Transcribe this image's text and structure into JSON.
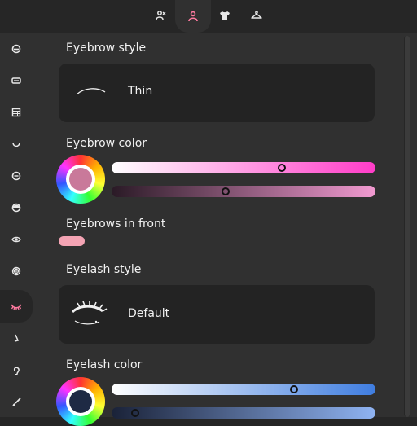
{
  "colors": {
    "accent": "#ff7aa0",
    "background": "#303030",
    "card": "#232323",
    "toggle": "#f4a4b4"
  },
  "top_tabs": [
    {
      "name": "tab-people",
      "icon": "people-icon",
      "active": false
    },
    {
      "name": "tab-body",
      "icon": "person-icon",
      "active": true
    },
    {
      "name": "tab-clothing",
      "icon": "shirt-icon",
      "active": false
    },
    {
      "name": "tab-hanger",
      "icon": "hanger-icon",
      "active": false
    }
  ],
  "sidebar_icons": [
    "head-icon",
    "forehead-icon",
    "hair-icon",
    "mouth-icon",
    "face-icon",
    "face-outline-icon",
    "eye-icon",
    "pupil-icon",
    "eyelash-icon",
    "eyebrow-pen-icon",
    "ear-icon",
    "brush-icon"
  ],
  "sections": {
    "eyebrow_style": {
      "label": "Eyebrow style",
      "value": "Thin"
    },
    "eyebrow_color": {
      "label": "Eyebrow color",
      "swatch": "#c9799a",
      "hue_fraction": 0.65,
      "shade_fraction": 0.43
    },
    "eyebrows_in_front": {
      "label": "Eyebrows in front"
    },
    "eyelash_style": {
      "label": "Eyelash style",
      "value": "Default"
    },
    "eyelash_color": {
      "label": "Eyelash color",
      "swatch": "#1e2a44",
      "hue_fraction": 0.7,
      "shade_fraction": 0.07
    }
  }
}
